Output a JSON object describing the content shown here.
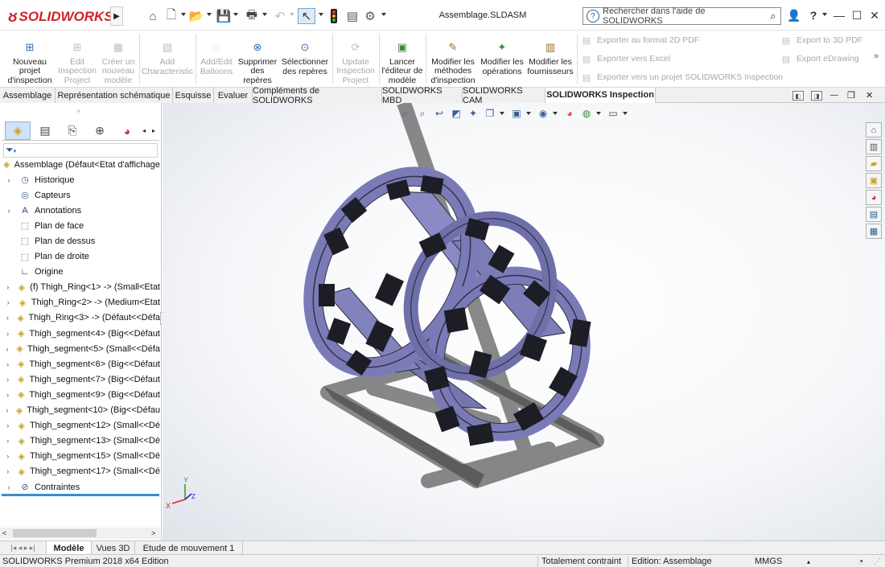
{
  "app": {
    "logo": "SOLIDWORKS",
    "document_title": "Assemblage.SLDASM",
    "search_placeholder": "Rechercher dans l'aide de SOLIDWORKS"
  },
  "ribbon": {
    "buttons": [
      {
        "label": "Nouveau projet d'inspection",
        "enabled": true,
        "icon": "new-project-icon"
      },
      {
        "label": "Edit Inspection Project",
        "enabled": false,
        "icon": "edit-project-icon"
      },
      {
        "label": "Créer un nouveau modèle",
        "enabled": false,
        "icon": "new-template-icon"
      },
      {
        "label": "Add Characteristic",
        "enabled": false,
        "icon": "add-characteristic-icon"
      },
      {
        "label": "Add/Edit Balloons",
        "enabled": false,
        "icon": "balloons-icon"
      },
      {
        "label": "Supprimer des repères",
        "enabled": true,
        "icon": "delete-markers-icon"
      },
      {
        "label": "Sélectionner des repères",
        "enabled": true,
        "icon": "select-markers-icon"
      },
      {
        "label": "Update Inspection Project",
        "enabled": false,
        "icon": "update-project-icon"
      },
      {
        "label": "Lancer l'éditeur de modèle",
        "enabled": true,
        "icon": "template-editor-icon"
      },
      {
        "label": "Modifier les méthodes d'inspection",
        "enabled": true,
        "icon": "inspection-methods-icon"
      },
      {
        "label": "Modifier les opérations",
        "enabled": true,
        "icon": "operations-icon"
      },
      {
        "label": "Modifier les fournisseurs",
        "enabled": true,
        "icon": "suppliers-icon"
      }
    ],
    "export_left": [
      "Exporter au format 2D PDF",
      "Exporter vers Excel",
      "Exporter vers un projet SOLIDWORKS Inspection"
    ],
    "export_right": [
      "Export to 3D PDF",
      "Export eDrawing"
    ]
  },
  "tabs": [
    "Assemblage",
    "Représentation schématique",
    "Esquisse",
    "Evaluer",
    "Compléments de SOLIDWORKS",
    "SOLIDWORKS MBD",
    "SOLIDWORKS CAM",
    "SOLIDWORKS Inspection"
  ],
  "active_tab": "SOLIDWORKS Inspection",
  "tree": {
    "root": "Assemblage  (Défaut<Etat d'affichage",
    "items": [
      {
        "label": "Historique",
        "icon": "history-icon"
      },
      {
        "label": "Capteurs",
        "icon": "sensor-icon"
      },
      {
        "label": "Annotations",
        "icon": "annotations-icon"
      },
      {
        "label": "Plan de face",
        "icon": "plane-icon"
      },
      {
        "label": "Plan de dessus",
        "icon": "plane-icon"
      },
      {
        "label": "Plan de droite",
        "icon": "plane-icon"
      },
      {
        "label": "Origine",
        "icon": "origin-icon"
      },
      {
        "label": "(f) Thigh_Ring<1> -> (Small<Etat",
        "icon": "part-icon"
      },
      {
        "label": "Thigh_Ring<2> -> (Medium<Etat",
        "icon": "part-icon"
      },
      {
        "label": "Thigh_Ring<3> -> (Défaut<<Défa",
        "icon": "part-icon"
      },
      {
        "label": "Thigh_segment<4> (Big<<Défaut",
        "icon": "part-icon"
      },
      {
        "label": "Thigh_segment<5> (Small<<Défa",
        "icon": "part-icon"
      },
      {
        "label": "Thigh_segment<6> (Big<<Défaut",
        "icon": "part-icon"
      },
      {
        "label": "Thigh_segment<7> (Big<<Défaut",
        "icon": "part-icon"
      },
      {
        "label": "Thigh_segment<9> (Big<<Défaut",
        "icon": "part-icon"
      },
      {
        "label": "Thigh_segment<10> (Big<<Défau",
        "icon": "part-icon"
      },
      {
        "label": "Thigh_segment<12> (Small<<Dé",
        "icon": "part-icon"
      },
      {
        "label": "Thigh_segment<13> (Small<<Dé",
        "icon": "part-icon"
      },
      {
        "label": "Thigh_segment<15> (Small<<Dé",
        "icon": "part-icon"
      },
      {
        "label": "Thigh_segment<17> (Small<<Dé",
        "icon": "part-icon"
      },
      {
        "label": "Contraintes",
        "icon": "mates-icon"
      }
    ]
  },
  "bottom_tabs": [
    "Modèle",
    "Vues 3D",
    "Etude de mouvement 1"
  ],
  "status": {
    "edition": "SOLIDWORKS Premium 2018 x64 Edition",
    "constraint": "Totalement contraint",
    "mode": "Edition: Assemblage",
    "units": "MMGS"
  },
  "triad": {
    "x": "X",
    "y": "Y",
    "z": "Z"
  },
  "colors": {
    "brand_red": "#d0232a",
    "model_fill": "#7e7fb8",
    "model_dark": "#1c1c24",
    "selection_blue": "#3a8fd0"
  }
}
